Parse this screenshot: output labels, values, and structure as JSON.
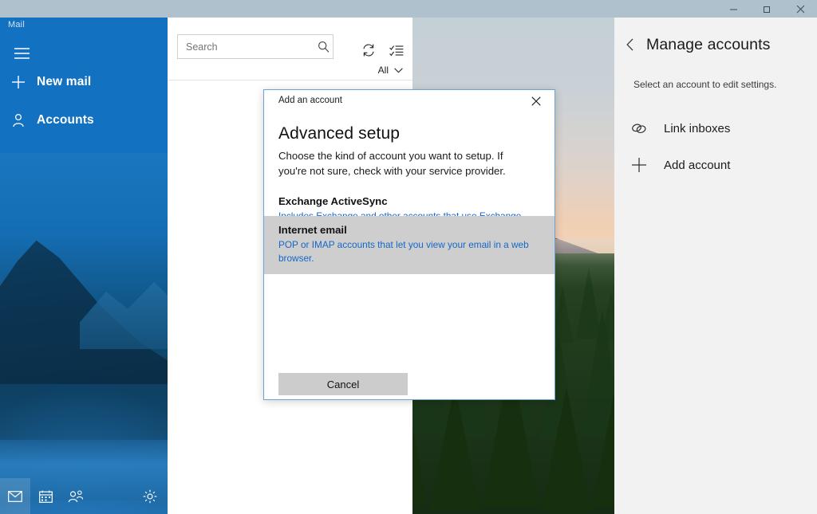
{
  "titlebar": {
    "minimize_label": "Minimize",
    "maximize_label": "Restore",
    "close_label": "Close"
  },
  "sidebar": {
    "app_title": "Mail",
    "menu_label": "Menu",
    "items": [
      {
        "label": "New mail",
        "icon": "plus-icon"
      },
      {
        "label": "Accounts",
        "icon": "person-icon"
      }
    ],
    "bottom_icons": [
      {
        "name": "mail-icon",
        "label": "Mail",
        "selected": true
      },
      {
        "name": "calendar-icon",
        "label": "Calendar",
        "selected": false
      },
      {
        "name": "people-icon",
        "label": "People",
        "selected": false
      },
      {
        "name": "settings-gear-icon",
        "label": "Settings",
        "selected": false
      }
    ]
  },
  "message_list": {
    "search": {
      "placeholder": "Search",
      "value": "",
      "icon": "search-icon"
    },
    "sync_icon": "sync-refresh-icon",
    "select_icon": "select-mode-icon",
    "filter": {
      "label": "All",
      "icon": "chevron-down-icon"
    }
  },
  "accounts_panel": {
    "back_icon": "chevron-left-icon",
    "title": "Manage accounts",
    "subtitle": "Select an account to edit settings.",
    "items": [
      {
        "label": "Link inboxes",
        "icon": "link-inboxes-icon"
      },
      {
        "label": "Add account",
        "icon": "plus-icon"
      }
    ]
  },
  "dialog": {
    "window_title": "Add an account",
    "close_icon": "close-icon",
    "heading": "Advanced setup",
    "description": "Choose the kind of account you want to setup. If you're not sure, check with your service provider.",
    "options": [
      {
        "title": "Exchange ActiveSync",
        "description": "Includes Exchange and other accounts that use Exchange ActiveSync.",
        "selected": false
      },
      {
        "title": "Internet email",
        "description": "POP or IMAP accounts that let you view your email in a web browser.",
        "selected": true
      }
    ],
    "cancel_label": "Cancel"
  },
  "colors": {
    "accent_blue": "#1271c0",
    "titlebar": "#aec1cd",
    "link_blue": "#1567c8",
    "selection_gray": "#cecece",
    "panel_gray": "#f2f2f2"
  }
}
